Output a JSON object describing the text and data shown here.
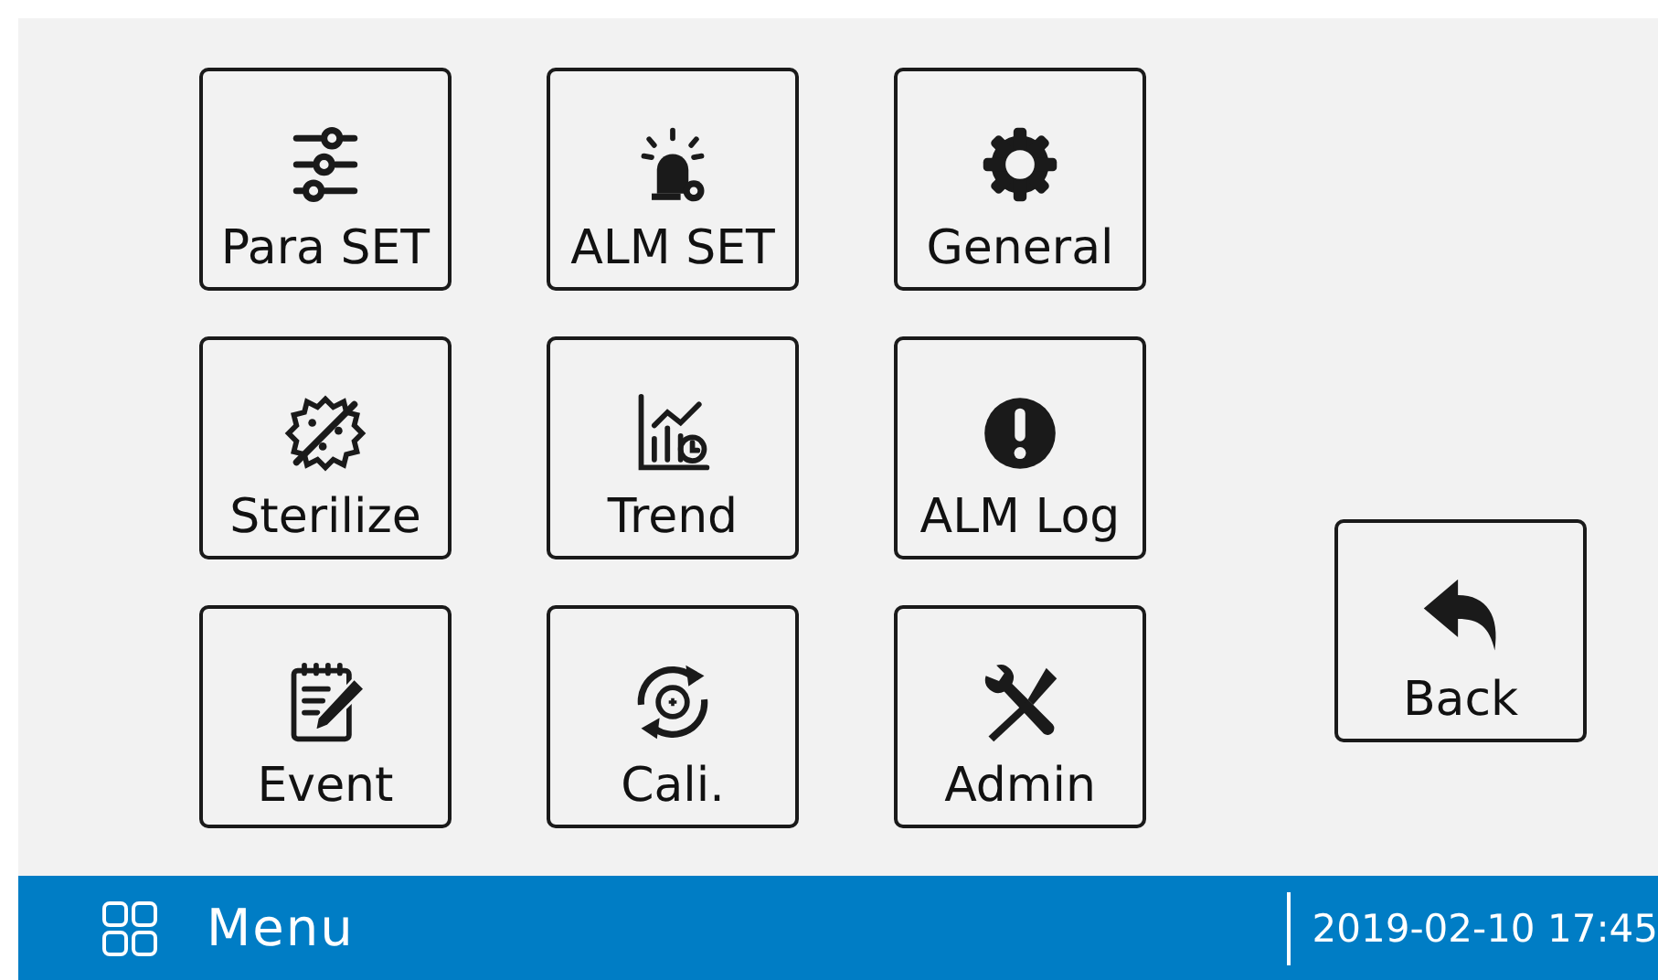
{
  "menu_buttons": [
    {
      "label": "Para SET"
    },
    {
      "label": "ALM SET"
    },
    {
      "label": "General"
    },
    {
      "label": "Sterilize"
    },
    {
      "label": "Trend"
    },
    {
      "label": "ALM Log"
    },
    {
      "label": "Event"
    },
    {
      "label": "Cali."
    },
    {
      "label": "Admin"
    }
  ],
  "back_button": {
    "label": "Back"
  },
  "status_bar": {
    "title": "Menu",
    "datetime": "2019-02-10 17:45"
  }
}
